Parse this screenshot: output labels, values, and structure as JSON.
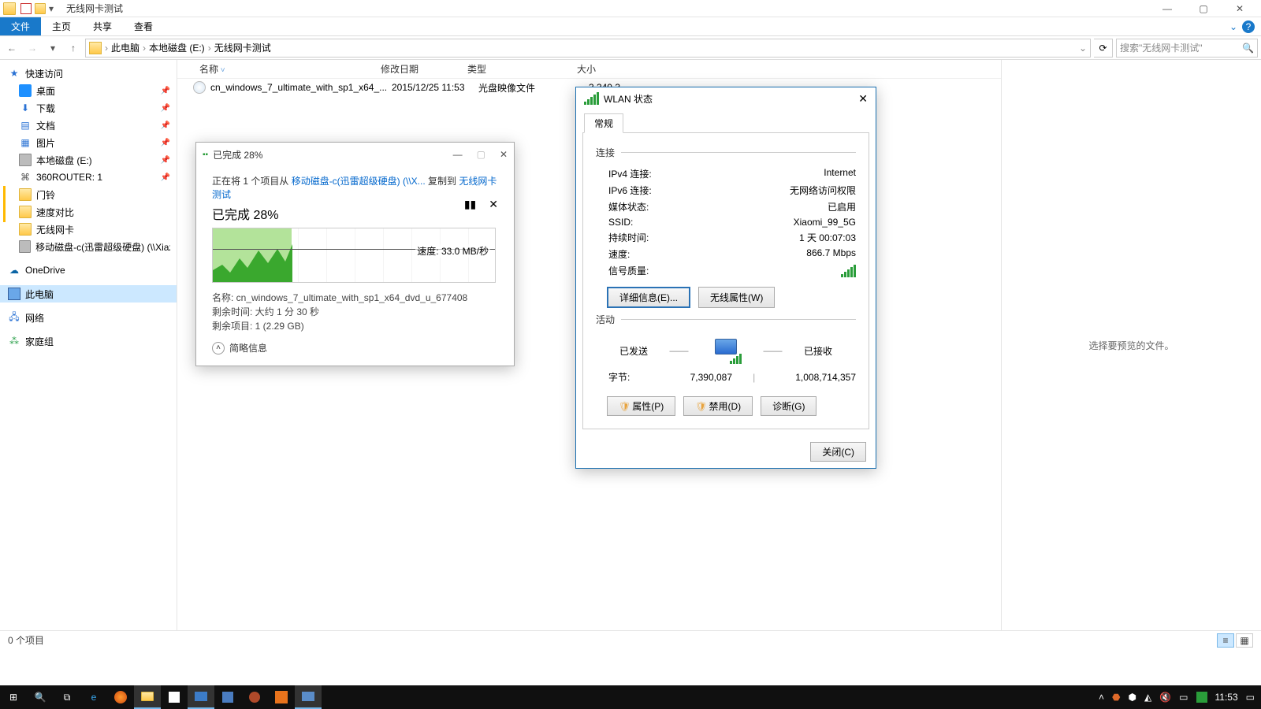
{
  "titlebar": {
    "title": "无线网卡测试"
  },
  "wincontrols": {
    "min": "—",
    "max": "▢",
    "close": "✕"
  },
  "ribbon": {
    "file": "文件",
    "home": "主页",
    "share": "共享",
    "view": "查看",
    "help_caret": "⌄",
    "help": "?"
  },
  "addr": {
    "back": "←",
    "fwd": "→",
    "recent": "▾",
    "up": "↑",
    "crumbs": [
      "此电脑",
      "本地磁盘 (E:)",
      "无线网卡测试"
    ],
    "sep": "›",
    "dropdown": "⌄",
    "refresh": "⟳",
    "search_placeholder": "搜索\"无线网卡测试\"",
    "search_icon": "🔍"
  },
  "cols": {
    "name": "名称",
    "date": "修改日期",
    "type": "类型",
    "size": "大小"
  },
  "file_row": {
    "name": "cn_windows_7_ultimate_with_sp1_x64_...",
    "date": "2015/12/25 11:53",
    "type": "光盘映像文件",
    "size": "3,340,3"
  },
  "sidebar": {
    "quick": "快速访问",
    "desktop": "桌面",
    "downloads": "下载",
    "documents": "文档",
    "pictures": "图片",
    "localE": "本地磁盘 (E:)",
    "router": "360ROUTER: 1",
    "menling": "门铃",
    "compare": "速度对比",
    "wlcard": "无线网卡",
    "mobdisk": "移动磁盘-c(迅雷超级硬盘) (\\\\Xiaza",
    "onedrive": "OneDrive",
    "thispc": "此电脑",
    "network": "网络",
    "homegroup": "家庭组",
    "pin": "📌"
  },
  "preview": "选择要预览的文件。",
  "status": {
    "count": "0 个项目"
  },
  "copy": {
    "title_icon": "▪▪",
    "title": "已完成 28%",
    "min": "—",
    "max": "▢",
    "close": "✕",
    "line_prefix": "正在将 1 个项目从 ",
    "src": "移动磁盘-c(迅雷超级硬盘) (\\\\X...",
    "line_mid": " 复制到 ",
    "dst": "无线网卡测试",
    "big": "已完成 28%",
    "pause": "▮▮",
    "cancel": "✕",
    "speed": "速度: 33.0 MB/秒",
    "name_label": "名称: ",
    "name": "cn_windows_7_ultimate_with_sp1_x64_dvd_u_677408",
    "time_label": "剩余时间: ",
    "time": "大约 1 分 30 秒",
    "left_label": "剩余项目: ",
    "left": "1 (2.29 GB)",
    "less": "简略信息",
    "chev": "˄"
  },
  "wlan": {
    "title": "WLAN 状态",
    "tab": "常规",
    "sect_conn": "连接",
    "sect_act": "活动",
    "ipv4_l": "IPv4 连接:",
    "ipv4_v": "Internet",
    "ipv6_l": "IPv6 连接:",
    "ipv6_v": "无网络访问权限",
    "media_l": "媒体状态:",
    "media_v": "已启用",
    "ssid_l": "SSID:",
    "ssid_v": "Xiaomi_99_5G",
    "dur_l": "持续时间:",
    "dur_v": "1 天 00:07:03",
    "speed_l": "速度:",
    "speed_v": "866.7 Mbps",
    "sig_l": "信号质量:",
    "btn_details": "详细信息(E)...",
    "btn_wprops": "无线属性(W)",
    "sent": "已发送",
    "recv": "已接收",
    "bytes_l": "字节:",
    "bytes_sent": "7,390,087",
    "bytes_recv": "1,008,714,357",
    "btn_props": "属性(P)",
    "btn_disable": "禁用(D)",
    "btn_diag": "诊断(G)",
    "btn_close": "关闭(C)",
    "shield": "🛡",
    "x": "✕"
  },
  "taskbar": {
    "start": "⊞",
    "search": "🔍",
    "taskview": "⧉",
    "tray_up": "˄",
    "clock": "11:53"
  }
}
